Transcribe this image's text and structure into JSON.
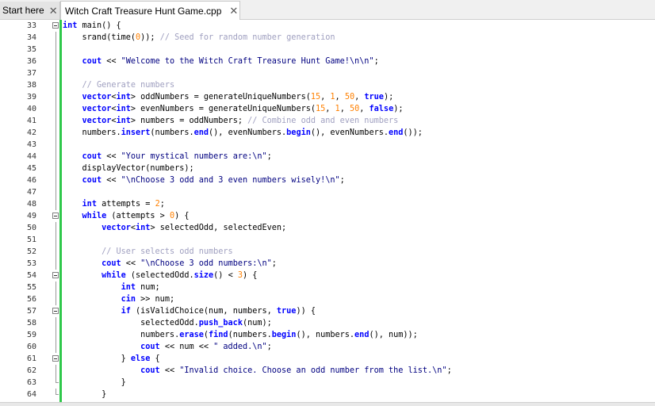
{
  "tabs": [
    {
      "label": "Start here",
      "close": "✕"
    },
    {
      "label": "Witch Craft Treasure Hunt Game.cpp",
      "close": "✕"
    }
  ],
  "lines": [
    {
      "n": "33",
      "fold": "open",
      "html": "<span class=\"kw\">int</span> main() {"
    },
    {
      "n": "34",
      "fold": "line",
      "html": "    srand(time(<span class=\"num\">0</span>)); <span class=\"com\">// Seed for random number generation</span>"
    },
    {
      "n": "35",
      "fold": "line",
      "html": ""
    },
    {
      "n": "36",
      "fold": "line",
      "html": "    <span class=\"kw\">cout</span> &lt;&lt; <span class=\"str\">\"Welcome to the Witch Craft Treasure Hunt Game!\\n\\n\"</span>;"
    },
    {
      "n": "37",
      "fold": "line",
      "html": ""
    },
    {
      "n": "38",
      "fold": "line",
      "html": "    <span class=\"com\">// Generate numbers</span>"
    },
    {
      "n": "39",
      "fold": "line",
      "html": "    <span class=\"kw\">vector</span>&lt;<span class=\"kw\">int</span>&gt; oddNumbers = generateUniqueNumbers(<span class=\"num\">15</span>, <span class=\"num\">1</span>, <span class=\"num\">50</span>, <span class=\"kw\">true</span>);"
    },
    {
      "n": "40",
      "fold": "line",
      "html": "    <span class=\"kw\">vector</span>&lt;<span class=\"kw\">int</span>&gt; evenNumbers = generateUniqueNumbers(<span class=\"num\">15</span>, <span class=\"num\">1</span>, <span class=\"num\">50</span>, <span class=\"kw\">false</span>);"
    },
    {
      "n": "41",
      "fold": "line",
      "html": "    <span class=\"kw\">vector</span>&lt;<span class=\"kw\">int</span>&gt; numbers = oddNumbers; <span class=\"com\">// Combine odd and even numbers</span>"
    },
    {
      "n": "42",
      "fold": "line",
      "html": "    numbers.<span class=\"kw\">insert</span>(numbers.<span class=\"kw\">end</span>(), evenNumbers.<span class=\"kw\">begin</span>(), evenNumbers.<span class=\"kw\">end</span>());"
    },
    {
      "n": "43",
      "fold": "line",
      "html": ""
    },
    {
      "n": "44",
      "fold": "line",
      "html": "    <span class=\"kw\">cout</span> &lt;&lt; <span class=\"str\">\"Your mystical numbers are:\\n\"</span>;"
    },
    {
      "n": "45",
      "fold": "line",
      "html": "    displayVector(numbers);"
    },
    {
      "n": "46",
      "fold": "line",
      "html": "    <span class=\"kw\">cout</span> &lt;&lt; <span class=\"str\">\"\\nChoose 3 odd and 3 even numbers wisely!\\n\"</span>;"
    },
    {
      "n": "47",
      "fold": "line",
      "html": ""
    },
    {
      "n": "48",
      "fold": "line",
      "html": "    <span class=\"kw\">int</span> attempts = <span class=\"num\">2</span>;"
    },
    {
      "n": "49",
      "fold": "open",
      "html": "    <span class=\"kw\">while</span> (attempts &gt; <span class=\"num\">0</span>) {"
    },
    {
      "n": "50",
      "fold": "line",
      "html": "        <span class=\"kw\">vector</span>&lt;<span class=\"kw\">int</span>&gt; selectedOdd, selectedEven;"
    },
    {
      "n": "51",
      "fold": "line",
      "html": ""
    },
    {
      "n": "52",
      "fold": "line",
      "html": "        <span class=\"com\">// User selects odd numbers</span>"
    },
    {
      "n": "53",
      "fold": "line",
      "html": "        <span class=\"kw\">cout</span> &lt;&lt; <span class=\"str\">\"\\nChoose 3 odd numbers:\\n\"</span>;"
    },
    {
      "n": "54",
      "fold": "open",
      "html": "        <span class=\"kw\">while</span> (selectedOdd.<span class=\"kw\">size</span>() &lt; <span class=\"num\">3</span>) {"
    },
    {
      "n": "55",
      "fold": "line",
      "html": "            <span class=\"kw\">int</span> num;"
    },
    {
      "n": "56",
      "fold": "line",
      "html": "            <span class=\"kw\">cin</span> &gt;&gt; num;"
    },
    {
      "n": "57",
      "fold": "open",
      "html": "            <span class=\"kw\">if</span> (isValidChoice(num, numbers, <span class=\"kw\">true</span>)) {"
    },
    {
      "n": "58",
      "fold": "line",
      "html": "                selectedOdd.<span class=\"kw\">push_back</span>(num);"
    },
    {
      "n": "59",
      "fold": "line",
      "html": "                numbers.<span class=\"kw\">erase</span>(<span class=\"kw\">find</span>(numbers.<span class=\"kw\">begin</span>(), numbers.<span class=\"kw\">end</span>(), num));"
    },
    {
      "n": "60",
      "fold": "line",
      "html": "                <span class=\"kw\">cout</span> &lt;&lt; num &lt;&lt; <span class=\"str\">\" added.\\n\"</span>;"
    },
    {
      "n": "61",
      "fold": "open",
      "html": "            } <span class=\"kw\">else</span> {"
    },
    {
      "n": "62",
      "fold": "line",
      "html": "                <span class=\"kw\">cout</span> &lt;&lt; <span class=\"str\">\"Invalid choice. Choose an odd number from the list.\\n\"</span>;"
    },
    {
      "n": "63",
      "fold": "end",
      "html": "            }"
    },
    {
      "n": "64",
      "fold": "end",
      "html": "        }"
    }
  ]
}
